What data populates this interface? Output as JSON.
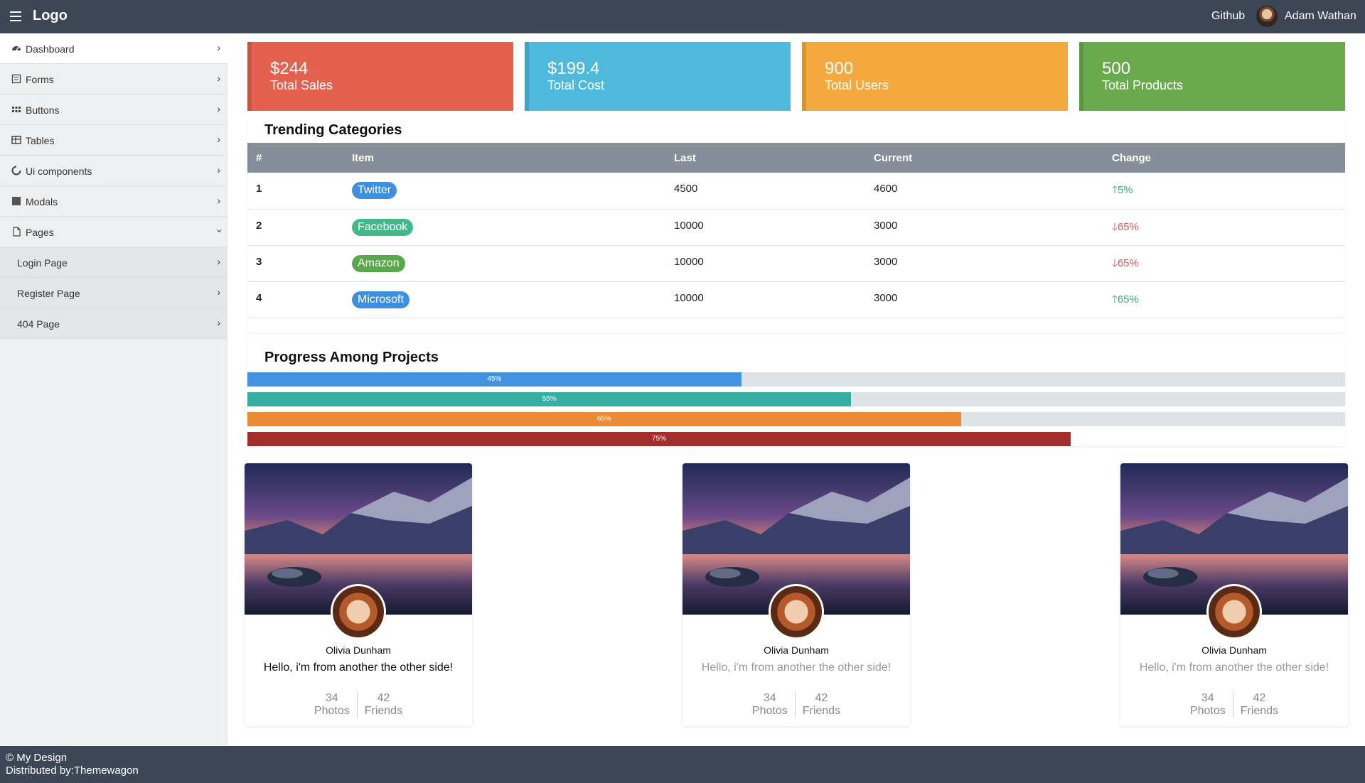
{
  "topbar": {
    "logo": "Logo",
    "github": "Github",
    "user_name": "Adam Wathan"
  },
  "sidebar": {
    "items": [
      {
        "label": "Dashboard",
        "icon": "dashboard-icon"
      },
      {
        "label": "Forms",
        "icon": "form-icon"
      },
      {
        "label": "Buttons",
        "icon": "grid-icon"
      },
      {
        "label": "Tables",
        "icon": "table-icon"
      },
      {
        "label": "Ui components",
        "icon": "spinner-icon"
      },
      {
        "label": "Modals",
        "icon": "square-icon"
      },
      {
        "label": "Pages",
        "icon": "file-icon"
      }
    ],
    "sub_items": [
      {
        "label": "Login Page"
      },
      {
        "label": "Register Page"
      },
      {
        "label": "404 Page"
      }
    ]
  },
  "stats": [
    {
      "value": "$244",
      "label": "Total Sales",
      "color": "#e4604f"
    },
    {
      "value": "$199.4",
      "label": "Total Cost",
      "color": "#4fb9dc"
    },
    {
      "value": "900",
      "label": "Total Users",
      "color": "#f4a93f"
    },
    {
      "value": "500",
      "label": "Total Products",
      "color": "#6aaa4f"
    }
  ],
  "trending": {
    "title": "Trending Categories",
    "headers": [
      "#",
      "Item",
      "Last",
      "Current",
      "Change"
    ],
    "rows": [
      {
        "num": "1",
        "item": "Twitter",
        "item_color": "#3f8fe0",
        "last": "4500",
        "current": "4600",
        "change": "5%",
        "direction": "up"
      },
      {
        "num": "2",
        "item": "Facebook",
        "item_color": "#45b88a",
        "last": "10000",
        "current": "3000",
        "change": "65%",
        "direction": "down"
      },
      {
        "num": "3",
        "item": "Amazon",
        "item_color": "#5aa84c",
        "last": "10000",
        "current": "3000",
        "change": "65%",
        "direction": "down"
      },
      {
        "num": "4",
        "item": "Microsoft",
        "item_color": "#3f8fe0",
        "last": "10000",
        "current": "3000",
        "change": "65%",
        "direction": "up"
      }
    ]
  },
  "progress": {
    "title": "Progress Among Projects",
    "bars": [
      {
        "label": "45%",
        "value": 0.45,
        "color": "#4393e0"
      },
      {
        "label": "55%",
        "value": 0.55,
        "color": "#36aea2"
      },
      {
        "label": "65%",
        "value": 0.65,
        "color": "#ea8a35"
      },
      {
        "label": "75%",
        "value": 0.75,
        "color": "#a42e2e"
      }
    ]
  },
  "profiles": [
    {
      "name": "Olivia Dunham",
      "bio": "Hello, i'm from another the other side!",
      "bio_color": "#111111",
      "photos": "34",
      "photos_label": "Photos",
      "friends": "42",
      "friends_label": "Friends"
    },
    {
      "name": "Olivia Dunham",
      "bio": "Hello, i'm from another the other side!",
      "bio_color": "#999999",
      "photos": "34",
      "photos_label": "Photos",
      "friends": "42",
      "friends_label": "Friends"
    },
    {
      "name": "Olivia Dunham",
      "bio": "Hello, i'm from another the other side!",
      "bio_color": "#999999",
      "photos": "34",
      "photos_label": "Photos",
      "friends": "42",
      "friends_label": "Friends"
    }
  ],
  "footer": {
    "line1": "© My Design",
    "line2": "Distributed by:Themewagon"
  }
}
